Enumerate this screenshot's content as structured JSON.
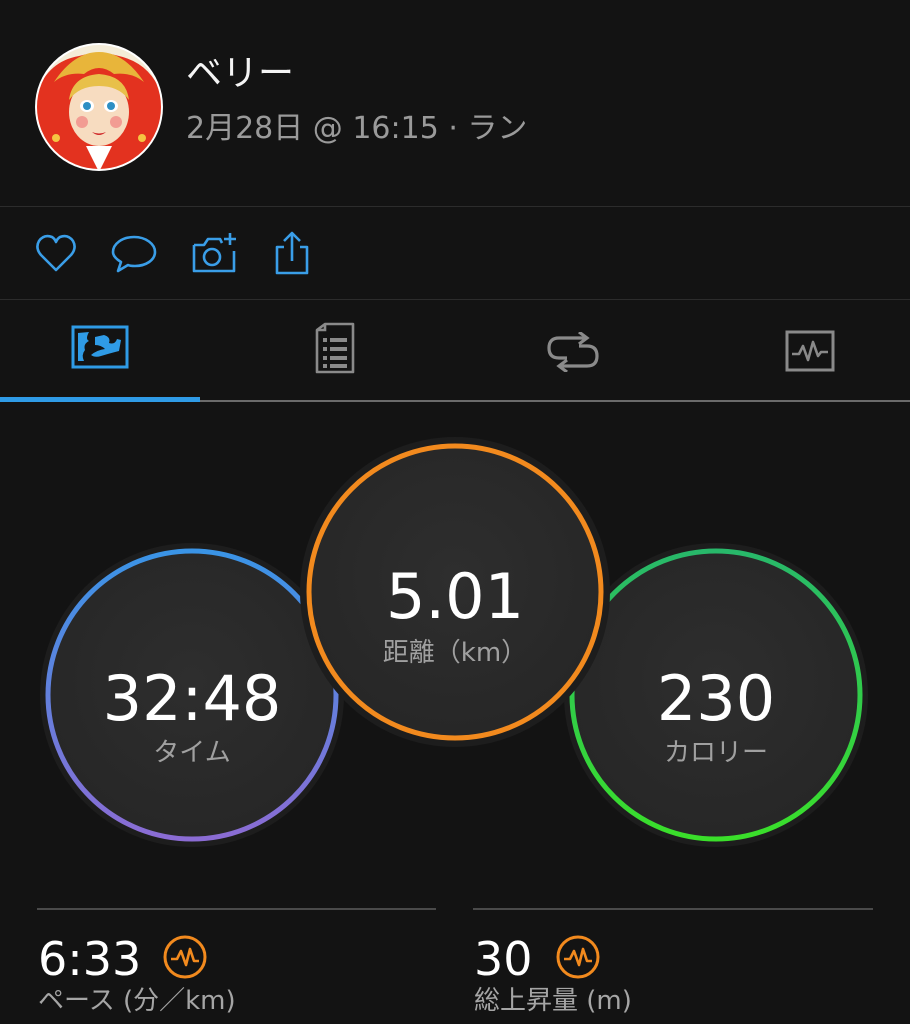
{
  "post": {
    "user_name": "ベリー",
    "meta": "2月28日 @ 16:15 · ラン"
  },
  "actions": {
    "icons": [
      "heart-icon",
      "comment-icon",
      "add-photo-icon",
      "share-icon"
    ]
  },
  "tabs": {
    "icons": [
      "map-overview-icon",
      "details-icon",
      "laps-icon",
      "charts-icon"
    ],
    "active_index": 0
  },
  "stats": {
    "time": {
      "value": "32:48",
      "label": "タイム"
    },
    "distance": {
      "value": "5.01",
      "label": "距離（km）"
    },
    "calories": {
      "value": "230",
      "label": "カロリー"
    }
  },
  "bottom_stats": {
    "pace": {
      "value": "6:33",
      "label": "ペース (分／km)"
    },
    "ascent": {
      "value": "30",
      "label": "総上昇量 (m)"
    }
  },
  "colors": {
    "background": "#131313",
    "accent": "#2f9be6",
    "orange": "#f28a1e",
    "green": "#2fd14a",
    "blue": "#3a94e6",
    "purple": "#8b6cd4"
  }
}
